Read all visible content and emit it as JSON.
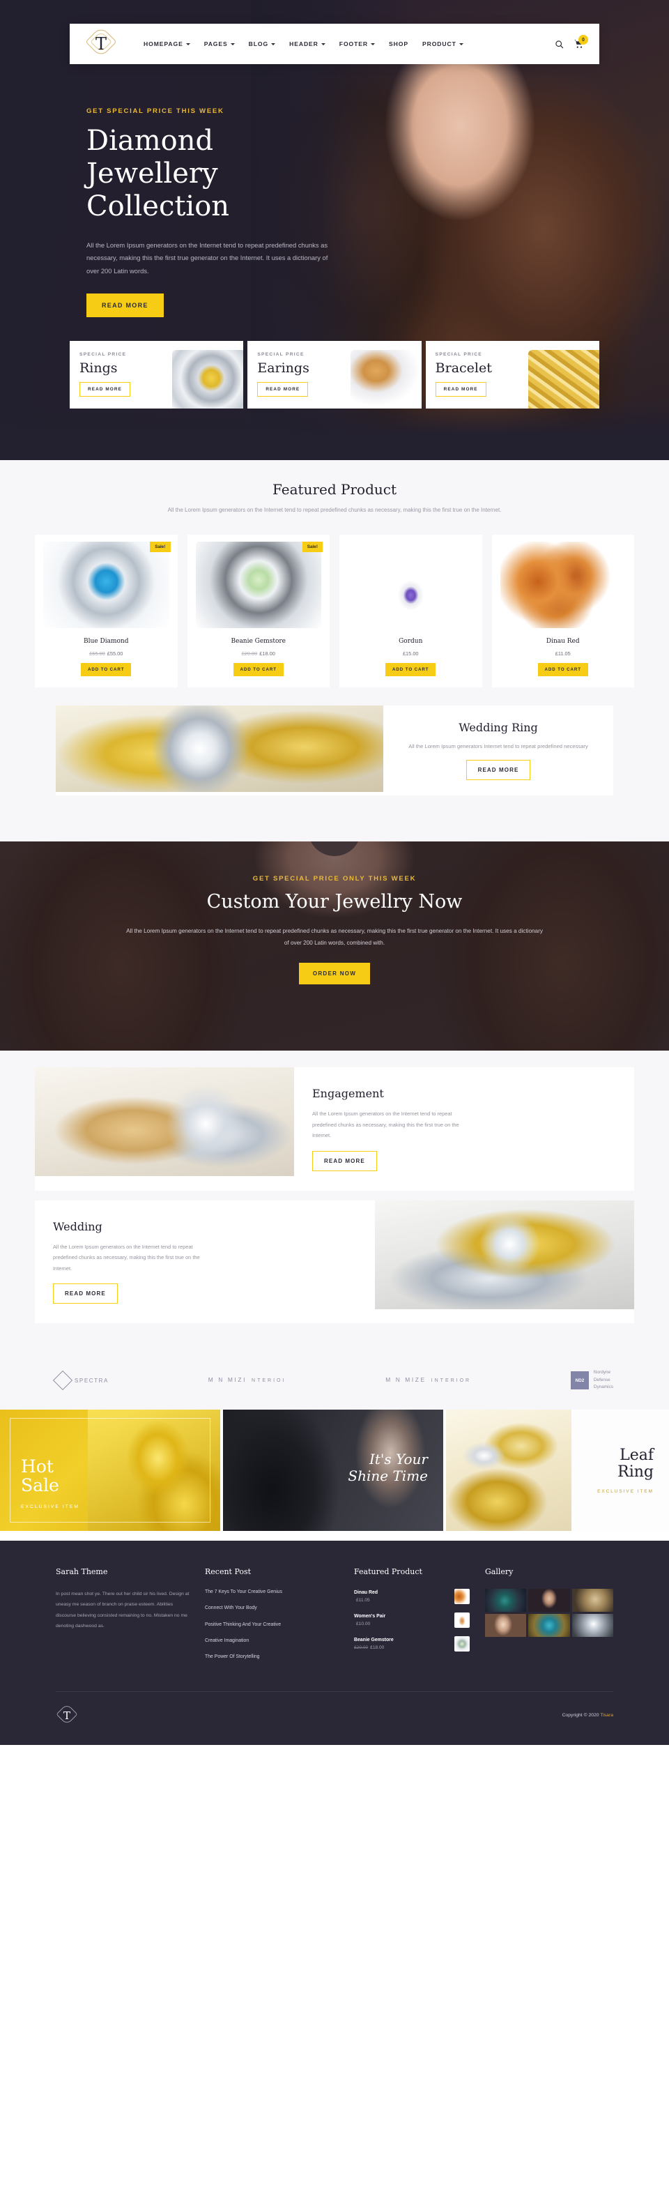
{
  "nav": {
    "logo_letter": "T",
    "items": [
      {
        "label": "HOMEPAGE",
        "caret": true
      },
      {
        "label": "PAGES",
        "caret": true
      },
      {
        "label": "BLOG",
        "caret": true
      },
      {
        "label": "HEADER",
        "caret": true
      },
      {
        "label": "FOOTER",
        "caret": true
      },
      {
        "label": "SHOP",
        "caret": false
      },
      {
        "label": "PRODUCT",
        "caret": true
      }
    ],
    "cart_count": "0"
  },
  "hero": {
    "eyebrow": "GET SPECIAL PRICE THIS WEEK",
    "title": "Diamond Jewellery Collection",
    "text": "All the Lorem Ipsum generators on the Internet tend to repeat predefined chunks as necessary, making this the first true generator on the Internet. It uses a dictionary of over 200 Latin words.",
    "cta": "READ MORE"
  },
  "categories": [
    {
      "label": "SPECIAL PRICE",
      "title": "Rings",
      "cta": "READ MORE"
    },
    {
      "label": "SPECIAL PRICE",
      "title": "Earings",
      "cta": "READ MORE"
    },
    {
      "label": "SPECIAL PRICE",
      "title": "Bracelet",
      "cta": "READ MORE"
    }
  ],
  "featured": {
    "title": "Featured Product",
    "subtitle": "All the Lorem Ipsum generators on the Internet tend to repeat predefined chunks as necessary, making this the first true on the Internet.",
    "products": [
      {
        "badge": "Sale!",
        "name": "Blue Diamond",
        "old_price": "£65.00",
        "price": "£55.00",
        "cta": "ADD TO CART"
      },
      {
        "badge": "Sale!",
        "name": "Beanie Gemstore",
        "old_price": "£20.00",
        "price": "£18.00",
        "cta": "ADD TO CART"
      },
      {
        "badge": "",
        "name": "Gordun",
        "old_price": "",
        "price": "£15.00",
        "cta": "ADD TO CART"
      },
      {
        "badge": "",
        "name": "Dinau Red",
        "old_price": "",
        "price": "£11.05",
        "cta": "ADD TO CART"
      }
    ]
  },
  "wedding_banner": {
    "title": "Wedding Ring",
    "text": "All the Lorem Ipsum generators  Internet tend to repeat predefined necessary",
    "cta": "READ MORE"
  },
  "custom_cta": {
    "eyebrow": "GET SPECIAL PRICE ONLY THIS WEEK",
    "title": "Custom Your Jewellry Now",
    "text": "All the Lorem Ipsum generators on the Internet tend to repeat predefined chunks as necessary, making this the first true generator on the Internet. It uses a dictionary of over 200 Latin words, combined with.",
    "cta": "ORDER NOW"
  },
  "collections": [
    {
      "title": "Engagement",
      "text": "All the Lorem Ipsum generators on the Internet tend to repeat predefined chunks as necessary, making this the first true on the Internet.",
      "cta": "READ MORE"
    },
    {
      "title": "Wedding",
      "text": "All the Lorem Ipsum generators on the Internet tend to repeat predefined chunks as necessary, making this the first true on the Internet.",
      "cta": "READ MORE"
    }
  ],
  "brands": [
    {
      "name": "SPECTRA",
      "type": "diamond"
    },
    {
      "line1": "M N MIZI",
      "line2": "NTERIOI",
      "type": "stack"
    },
    {
      "line1": "M N MIZE",
      "line2": "INTERIOR",
      "type": "stack"
    },
    {
      "tag": "ND2",
      "line1": "Nordyne",
      "line2": "Defense",
      "line3": "Dynamics",
      "type": "badge"
    }
  ],
  "promos": [
    {
      "title_line1": "Hot",
      "title_line2": "Sale",
      "subtitle": "EXCLUSIVE ITEM"
    },
    {
      "title_line1": "It's Your",
      "title_line2": "Shine Time",
      "subtitle": ""
    },
    {
      "title_line1": "Leaf",
      "title_line2": "Ring",
      "subtitle": "EXCLUSIVE ITEM"
    }
  ],
  "footer": {
    "about": {
      "title": "Sarah Theme",
      "text": "In post mean shot ye. There out her child sir his lived. Design at uneasy me season of branch on praise esteem. Abilities discourse believing consisted remaining to no. Mistaken no me denoting dashwood as."
    },
    "recent": {
      "title": "Recent Post",
      "posts": [
        "The 7 Keys To Your Creative Genius",
        "Connect With Your Body",
        "Positive Thinking And Your Creative",
        "Creative Imagination",
        "The Power Of Storytelling"
      ]
    },
    "featured": {
      "title": "Featured Product",
      "products": [
        {
          "name": "Dinau Red",
          "old_price": "",
          "price": "£11.05"
        },
        {
          "name": "Women's Pair",
          "old_price": "",
          "price": "£10.00"
        },
        {
          "name": "Beanie Gemstore",
          "old_price": "£20.00",
          "price": "£18.00"
        }
      ]
    },
    "gallery": {
      "title": "Gallery"
    },
    "copyright_prefix": "Copyright © 2020 ",
    "copyright_brand": "Tisara",
    "logo_letter": "T"
  },
  "colors": {
    "accent": "#f6cd14",
    "dark": "#2a2737",
    "gold": "#e0a426"
  }
}
